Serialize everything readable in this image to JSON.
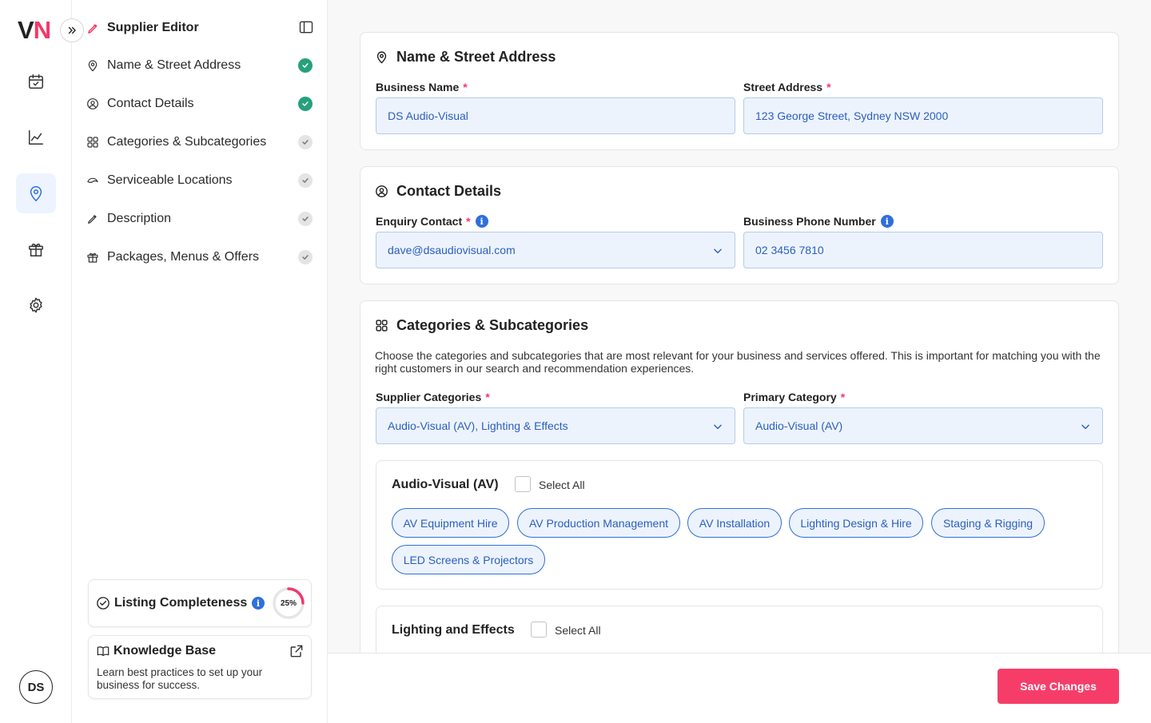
{
  "brand": {
    "logo_v": "V",
    "logo_n": "N",
    "accent": "#f2386a",
    "link_blue": "#2f6fdc",
    "done_green": "#26a17b"
  },
  "rail": {
    "items": [
      {
        "icon": "calendar-check-icon"
      },
      {
        "icon": "line-chart-icon"
      },
      {
        "icon": "map-pin-icon",
        "active": true
      },
      {
        "icon": "gift-icon"
      },
      {
        "icon": "gear-icon"
      }
    ],
    "avatar_initials": "DS"
  },
  "editor": {
    "title": "Supplier Editor",
    "nav": [
      {
        "label": "Name & Street Address",
        "status": "done"
      },
      {
        "label": "Contact Details",
        "status": "done"
      },
      {
        "label": "Categories & Subcategories",
        "status": "pending"
      },
      {
        "label": "Serviceable Locations",
        "status": "pending"
      },
      {
        "label": "Description",
        "status": "pending"
      },
      {
        "label": "Packages, Menus & Offers",
        "status": "pending"
      }
    ],
    "completeness": {
      "title": "Listing Completeness",
      "percent_label": "25%",
      "percent": 25
    },
    "knowledge_base": {
      "title": "Knowledge Base",
      "description": "Learn best practices to set up your business for success."
    }
  },
  "name_address": {
    "title": "Name & Street Address",
    "business_name_label": "Business Name",
    "business_name_value": "DS Audio-Visual",
    "street_address_label": "Street Address",
    "street_address_value": "123 George Street, Sydney NSW 2000",
    "required_mark": "*"
  },
  "contact": {
    "title": "Contact Details",
    "enquiry_label": "Enquiry Contact",
    "enquiry_value": "dave@dsaudiovisual.com",
    "phone_label": "Business Phone Number",
    "phone_value": "02 3456 7810",
    "required_mark": "*",
    "info_glyph": "i"
  },
  "categories": {
    "title": "Categories & Subcategories",
    "help_text": "Choose the categories and subcategories that are most relevant for your business and services offered. This is important for matching you with the right customers in our search and recommendation experiences.",
    "supplier_label": "Supplier Categories",
    "supplier_value": "Audio-Visual (AV), Lighting & Effects",
    "primary_label": "Primary Category",
    "primary_value": "Audio-Visual (AV)",
    "required_mark": "*",
    "groups": [
      {
        "title": "Audio-Visual (AV)",
        "select_all": "Select All",
        "chips": [
          "AV Equipment Hire",
          "AV Production Management",
          "AV Installation",
          "Lighting Design & Hire",
          "Staging & Rigging",
          "LED Screens & Projectors"
        ]
      },
      {
        "title": "Lighting and Effects",
        "select_all": "Select All"
      }
    ]
  },
  "footer": {
    "save_label": "Save Changes"
  }
}
